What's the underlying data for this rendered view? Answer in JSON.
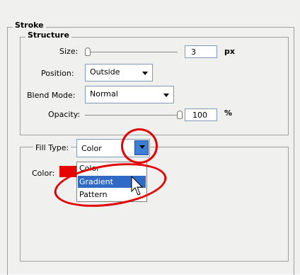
{
  "stroke": {
    "title": "Stroke",
    "structure": {
      "title": "Structure",
      "size": {
        "label": "Size:",
        "value": "3",
        "unit": "px",
        "slider_fraction": 0.0
      },
      "position": {
        "label": "Position:",
        "value": "Outside"
      },
      "blend_mode": {
        "label": "Blend Mode:",
        "value": "Normal"
      },
      "opacity": {
        "label": "Opacity:",
        "value": "100",
        "unit": "%",
        "slider_fraction": 1.0
      }
    },
    "fill": {
      "label": "Fill Type:",
      "value": "Color",
      "color_label": "Color:",
      "color_swatch": "#e80000",
      "options": [
        "Color",
        "Gradient",
        "Pattern"
      ],
      "highlighted_option": "Gradient"
    }
  },
  "colors": {
    "annotation": "#e20000",
    "highlight": "#316ac5",
    "panel": "#f0f0ee"
  }
}
